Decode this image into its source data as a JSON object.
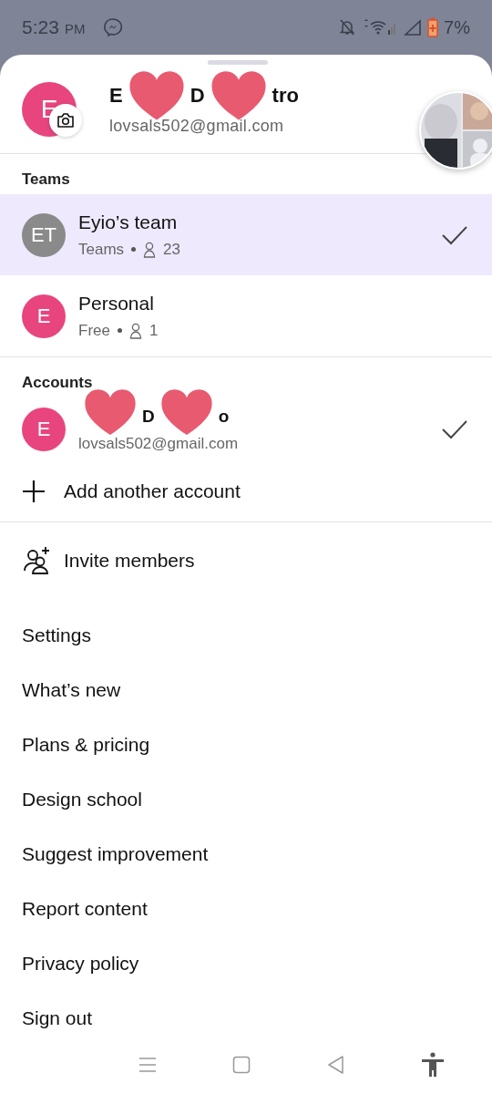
{
  "status_bar": {
    "time": "5:23",
    "ampm": "PM",
    "battery": "7%"
  },
  "profile": {
    "avatar": "E",
    "color": "#e8457f",
    "name_parts": [
      "E",
      "D",
      "tro"
    ],
    "email": "lovsals502@gmail.com"
  },
  "teams": {
    "heading": "Teams",
    "items": [
      {
        "avatar": "ET",
        "color": "#8a8a8a",
        "name": "Eyio’s team",
        "plan": "Teams",
        "members": "23",
        "selected": true
      },
      {
        "avatar": "E",
        "color": "#e8457f",
        "name": "Personal",
        "plan": "Free",
        "members": "1",
        "selected": false
      }
    ]
  },
  "accounts": {
    "heading": "Accounts",
    "items": [
      {
        "avatar": "E",
        "color": "#e8457f",
        "name_parts": [
          "D",
          "o"
        ],
        "email": "lovsals502@gmail.com",
        "selected": true
      }
    ]
  },
  "add_account": "Add another account",
  "invite": "Invite members",
  "menu": [
    "Settings",
    "What’s new",
    "Plans & pricing",
    "Design school",
    "Suggest improvement",
    "Report content",
    "Privacy policy",
    "Sign out"
  ]
}
